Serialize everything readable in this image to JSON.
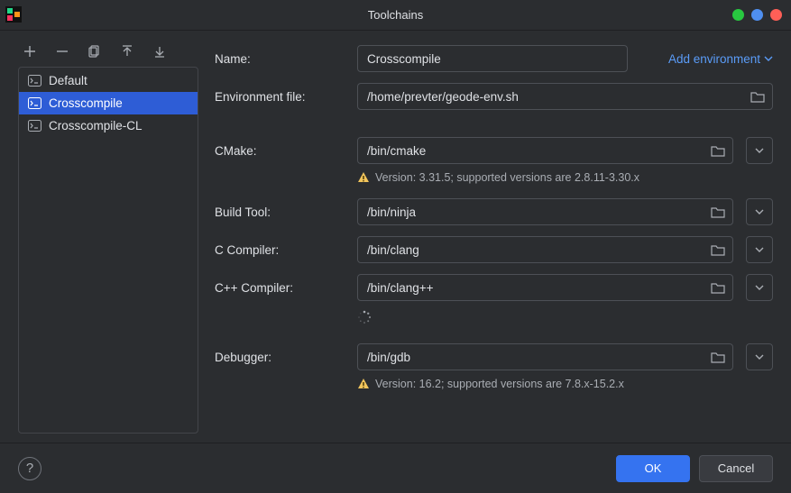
{
  "window": {
    "title": "Toolchains"
  },
  "sidebar": {
    "items": [
      {
        "label": "Default"
      },
      {
        "label": "Crosscompile"
      },
      {
        "label": "Crosscompile-CL"
      }
    ],
    "selected_index": 1
  },
  "form": {
    "name_label": "Name:",
    "name_value": "Crosscompile",
    "add_env_label": "Add environment",
    "env_file_label": "Environment file:",
    "env_file_value": "/home/prevter/geode-env.sh",
    "cmake_label": "CMake:",
    "cmake_value": "/bin/cmake",
    "cmake_warning": "Version: 3.31.5; supported versions are 2.8.11-3.30.x",
    "build_tool_label": "Build Tool:",
    "build_tool_value": "/bin/ninja",
    "c_compiler_label": "C Compiler:",
    "c_compiler_value": "/bin/clang",
    "cpp_compiler_label": "C++ Compiler:",
    "cpp_compiler_value": "/bin/clang++",
    "debugger_label": "Debugger:",
    "debugger_value": "/bin/gdb",
    "debugger_warning": "Version: 16.2; supported versions are 7.8.x-15.2.x"
  },
  "footer": {
    "ok": "OK",
    "cancel": "Cancel"
  }
}
